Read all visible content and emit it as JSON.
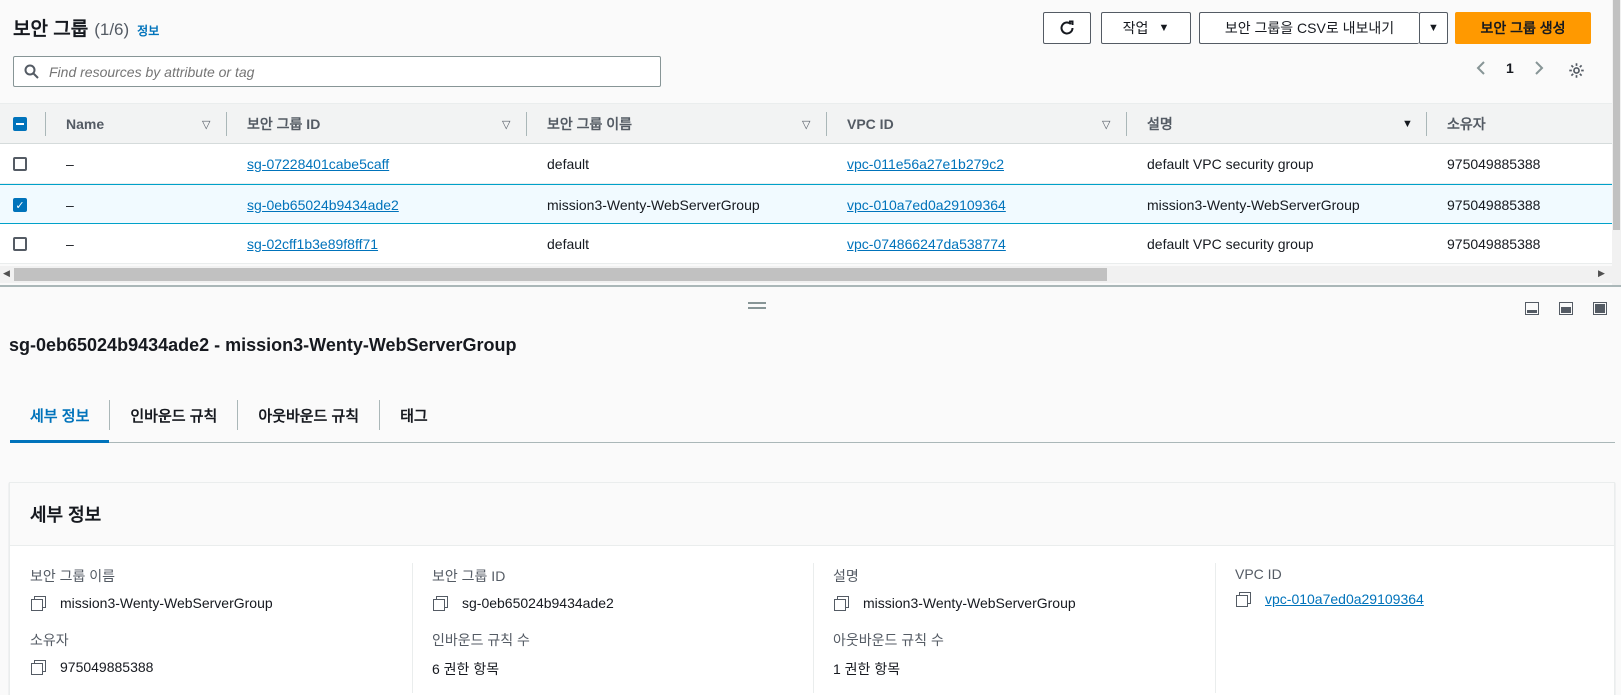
{
  "header": {
    "title": "보안 그룹",
    "count": "(1/6)",
    "info": "정보",
    "actions_label": "작업",
    "export_label": "보안 그룹을 CSV로 내보내기",
    "create_label": "보안 그룹 생성"
  },
  "search": {
    "placeholder": "Find resources by attribute or tag"
  },
  "pagination": {
    "page": "1"
  },
  "table": {
    "columns": [
      "Name",
      "보안 그룹 ID",
      "보안 그룹 이름",
      "VPC ID",
      "설명",
      "소유자"
    ],
    "rows": [
      {
        "name": "–",
        "id": "sg-07228401cabe5caff",
        "group_name": "default",
        "vpc": "vpc-011e56a27e1b279c2",
        "desc": "default VPC security group",
        "owner": "975049885388",
        "selected": false
      },
      {
        "name": "–",
        "id": "sg-0eb65024b9434ade2",
        "group_name": "mission3-Wenty-WebServerGroup",
        "vpc": "vpc-010a7ed0a29109364",
        "desc": "mission3-Wenty-WebServerGroup",
        "owner": "975049885388",
        "selected": true
      },
      {
        "name": "–",
        "id": "sg-02cff1b3e89f8ff71",
        "group_name": "default",
        "vpc": "vpc-074866247da538774",
        "desc": "default VPC security group",
        "owner": "975049885388",
        "selected": false
      }
    ]
  },
  "detail": {
    "title": "sg-0eb65024b9434ade2 - mission3-Wenty-WebServerGroup",
    "tabs": [
      "세부 정보",
      "인바운드 규칙",
      "아웃바운드 규칙",
      "태그"
    ],
    "card_title": "세부 정보",
    "fields": {
      "group_name_label": "보안 그룹 이름",
      "group_name": "mission3-Wenty-WebServerGroup",
      "group_id_label": "보안 그룹 ID",
      "group_id": "sg-0eb65024b9434ade2",
      "desc_label": "설명",
      "desc": "mission3-Wenty-WebServerGroup",
      "vpc_label": "VPC ID",
      "vpc": "vpc-010a7ed0a29109364",
      "owner_label": "소유자",
      "owner": "975049885388",
      "inbound_label": "인바운드 규칙 수",
      "inbound": "6 권한 항목",
      "outbound_label": "아웃바운드 규칙 수",
      "outbound": "1 권한 항목"
    }
  },
  "colors": {
    "accent": "#0073bb",
    "primary_button": "#ff9900"
  }
}
